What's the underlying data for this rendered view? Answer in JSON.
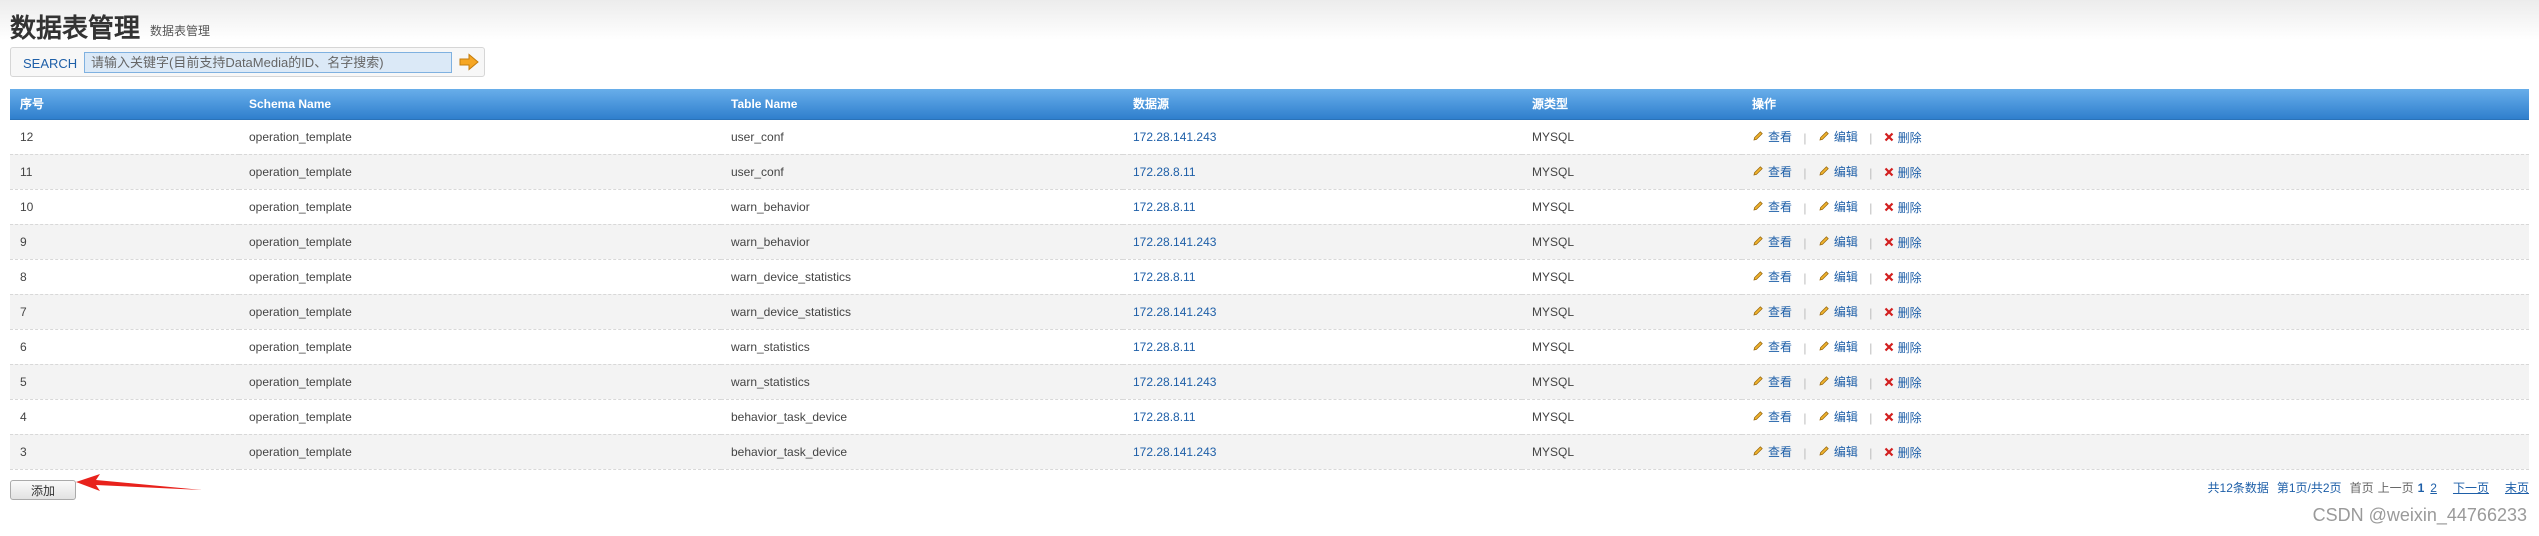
{
  "page": {
    "title": "数据表管理",
    "breadcrumb": "数据表管理"
  },
  "search": {
    "label": "SEARCH",
    "placeholder": "请输入关键字(目前支持DataMedia的ID、名字搜索)",
    "value": "",
    "go_icon": "arrow-right-icon"
  },
  "table": {
    "headers": [
      "序号",
      "Schema Name",
      "Table Name",
      "数据源",
      "源类型",
      "操作"
    ],
    "rows": [
      {
        "id": "12",
        "schema": "operation_template",
        "table": "user_conf",
        "source": "172.28.141.243",
        "type": "MYSQL"
      },
      {
        "id": "11",
        "schema": "operation_template",
        "table": "user_conf",
        "source": "172.28.8.11",
        "type": "MYSQL"
      },
      {
        "id": "10",
        "schema": "operation_template",
        "table": "warn_behavior",
        "source": "172.28.8.11",
        "type": "MYSQL"
      },
      {
        "id": "9",
        "schema": "operation_template",
        "table": "warn_behavior",
        "source": "172.28.141.243",
        "type": "MYSQL"
      },
      {
        "id": "8",
        "schema": "operation_template",
        "table": "warn_device_statistics",
        "source": "172.28.8.11",
        "type": "MYSQL"
      },
      {
        "id": "7",
        "schema": "operation_template",
        "table": "warn_device_statistics",
        "source": "172.28.141.243",
        "type": "MYSQL"
      },
      {
        "id": "6",
        "schema": "operation_template",
        "table": "warn_statistics",
        "source": "172.28.8.11",
        "type": "MYSQL"
      },
      {
        "id": "5",
        "schema": "operation_template",
        "table": "warn_statistics",
        "source": "172.28.141.243",
        "type": "MYSQL"
      },
      {
        "id": "4",
        "schema": "operation_template",
        "table": "behavior_task_device",
        "source": "172.28.8.11",
        "type": "MYSQL"
      },
      {
        "id": "3",
        "schema": "operation_template",
        "table": "behavior_task_device",
        "source": "172.28.141.243",
        "type": "MYSQL"
      }
    ],
    "actions": {
      "view": "查看",
      "edit": "编辑",
      "delete": "删除",
      "separator": "|"
    }
  },
  "footer": {
    "add_label": "添加"
  },
  "pagination": {
    "summary": "共12条数据",
    "current_text": "第1页/共2页",
    "first": "首页",
    "prev": "上一页",
    "current_page": "1",
    "page_2": "2",
    "next": "下一页",
    "last": "末页"
  },
  "watermark": "CSDN @weixin_44766233",
  "colors": {
    "header_blue": "#3b8ad6",
    "link_blue": "#1e5fa8",
    "delete_red": "#d21f1f",
    "arrow_red": "#e8221c",
    "go_orange": "#f6a623"
  }
}
